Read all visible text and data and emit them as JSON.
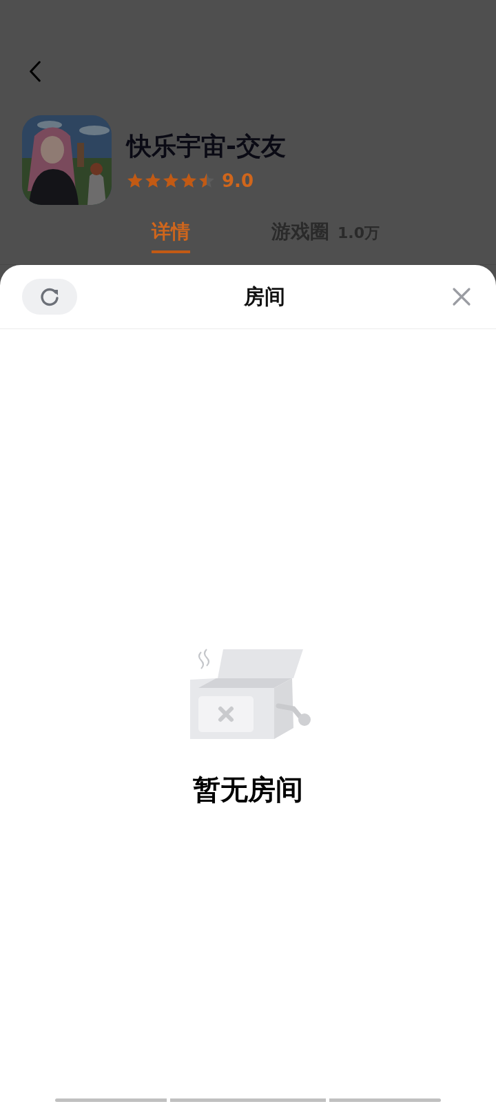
{
  "app": {
    "title": "快乐宇宙-交友",
    "stars": 4.5,
    "rating": "9.0"
  },
  "tabs": [
    {
      "label": "详情",
      "selected": true
    },
    {
      "label": "游戏圈",
      "count": "1.0万",
      "selected": false
    }
  ],
  "sheet": {
    "title": "房间",
    "empty_text": "暂无房间"
  }
}
